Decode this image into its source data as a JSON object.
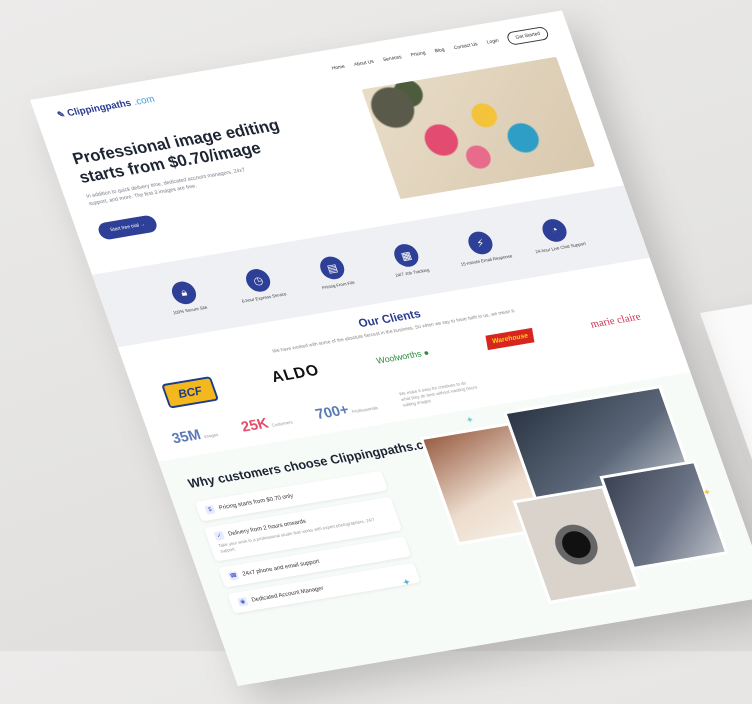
{
  "header": {
    "logo_brand": "Clippingpaths",
    "logo_domain": ".com",
    "nav": [
      "Home",
      "About Us",
      "Services",
      "Pricing",
      "Blog",
      "Contact Us",
      "Login"
    ],
    "cta": "Get Started"
  },
  "hero": {
    "title": "Professional image editing starts from $0.70/image",
    "subtitle": "In addition to quick delivery time, dedicated account managers, 24x7 support, and more. The first 3 images are free.",
    "button": "Start free trial"
  },
  "features": [
    {
      "icon": "lock-icon",
      "label": "100% Secure Site"
    },
    {
      "icon": "clock-icon",
      "label": "6-hour Express Service"
    },
    {
      "icon": "file-icon",
      "label": "Pricing From File"
    },
    {
      "icon": "tracking-icon",
      "label": "24/7 Job Tracking"
    },
    {
      "icon": "bolt-icon",
      "label": "15-minute Email Response"
    },
    {
      "icon": "chat-icon",
      "label": "24-hour Live Chat Support"
    }
  ],
  "clients": {
    "title": "Our Clients",
    "subtitle": "We have worked with some of the absolute fiercest in the business. So when we say to have faith in us, we mean it.",
    "logos": [
      "BCF",
      "ALDO",
      "Woolworths",
      "Warehouse",
      "marie claire"
    ]
  },
  "stats": [
    {
      "value": "35M",
      "label": "Images",
      "color": "#5b7bb5"
    },
    {
      "value": "25K",
      "label": "Customers",
      "color": "#e74c6a"
    },
    {
      "value": "700+",
      "label": "Professionals",
      "color": "#5b7bb5"
    }
  ],
  "stats_note": "We make it easy for creatives to do what they do best without wasting hours editing images",
  "why": {
    "title": "Why customers choose Clippingpaths.com",
    "benefits": [
      {
        "label": "Pricing starts from $0.70 only",
        "desc": ""
      },
      {
        "label": "Delivery from 2 hours onwards",
        "desc": "Take your work to a professional studio that works with expert photographers. 24/7 support."
      },
      {
        "label": "24x7 phone and email support",
        "desc": ""
      },
      {
        "label": "Dedicated Account Manager",
        "desc": ""
      }
    ]
  },
  "colors": {
    "brand_navy": "#2d3f96",
    "accent_pink": "#e74c6a",
    "accent_teal": "#3aa0e0"
  }
}
